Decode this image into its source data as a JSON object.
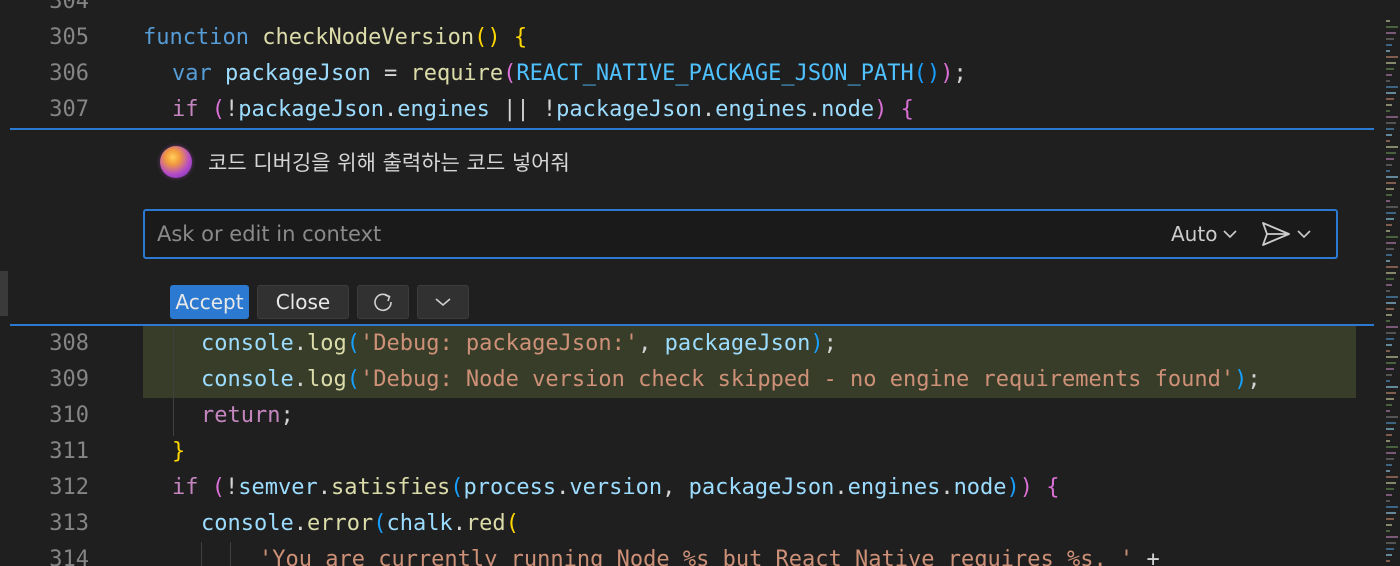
{
  "editor": {
    "lines": [
      {
        "num": "304",
        "code": ""
      },
      {
        "num": "305",
        "code": "function checkNodeVersion() {"
      },
      {
        "num": "306",
        "code": "var packageJson = require(REACT_NATIVE_PACKAGE_JSON_PATH());"
      },
      {
        "num": "307",
        "code": "if (!packageJson.engines || !packageJson.engines.node) {"
      },
      {
        "num": "308",
        "code": "console.log('Debug: packageJson:', packageJson);"
      },
      {
        "num": "309",
        "code": "console.log('Debug: Node version check skipped - no engine requirements found');"
      },
      {
        "num": "310",
        "code": "return;"
      },
      {
        "num": "311",
        "code": "}"
      },
      {
        "num": "312",
        "code": "if (!semver.satisfies(process.version, packageJson.engines.node)) {"
      },
      {
        "num": "313",
        "code": "console.error(chalk.red("
      },
      {
        "num": "314",
        "code": "'You are currently running Node %s but React Native requires %s. ' +"
      }
    ]
  },
  "inline_chat": {
    "prompt": "코드 디버깅을 위해 출력하는 코드 넣어줘",
    "input_placeholder": "Ask or edit in context",
    "mode_label": "Auto",
    "accept_label": "Accept",
    "close_label": "Close"
  },
  "colors": {
    "accent": "#2b79d0",
    "added_line_bg": "#373d29",
    "editor_bg": "#1f1f1f"
  }
}
